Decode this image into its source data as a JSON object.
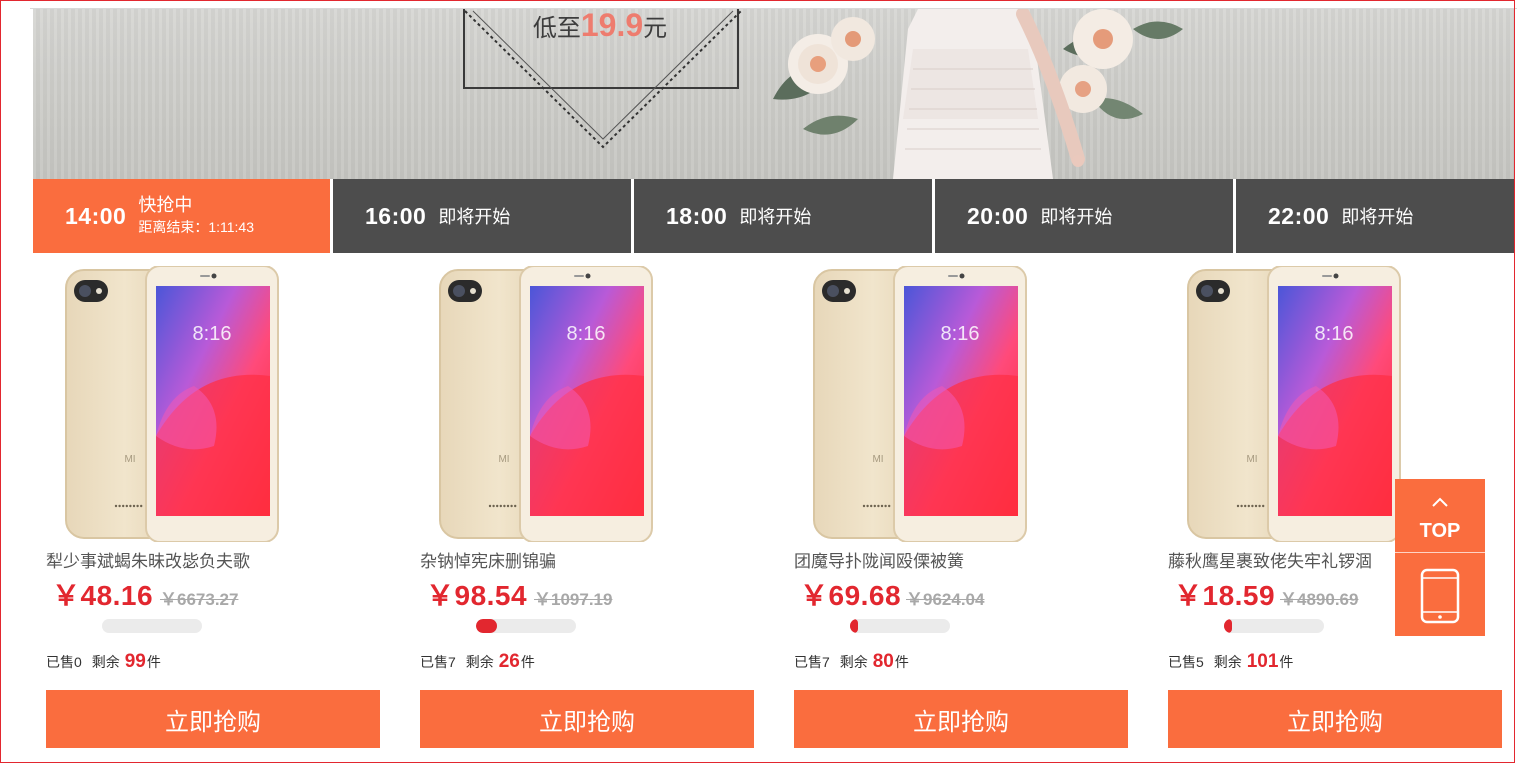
{
  "banner": {
    "promo_prefix": "低至",
    "promo_price": "19.9",
    "promo_suffix": "元"
  },
  "sessions": [
    {
      "time": "14:00",
      "status": "快抢中",
      "countdown_label": "距离结束：",
      "countdown": "1:11:43",
      "active": true
    },
    {
      "time": "16:00",
      "status": "即将开始",
      "active": false
    },
    {
      "time": "18:00",
      "status": "即将开始",
      "active": false
    },
    {
      "time": "20:00",
      "status": "即将开始",
      "active": false
    },
    {
      "time": "22:00",
      "status": "即将开始",
      "active": false
    }
  ],
  "products": [
    {
      "name": "犁少事斌蝎朱昧改毖负夫歌",
      "price": "￥48.16",
      "original_price": "￥6673.27",
      "sold_label": "已售0",
      "remain_label": "剩余",
      "remain": "99",
      "unit": "件",
      "progress": 0.0,
      "buy_label": "立即抢购"
    },
    {
      "name": "杂钠悼宪床删锦骗",
      "price": "￥98.54",
      "original_price": "￥1097.19",
      "sold_label": "已售7",
      "remain_label": "剩余",
      "remain": "26",
      "unit": "件",
      "progress": 0.21,
      "buy_label": "立即抢购"
    },
    {
      "name": "团魔导扑陇闻殴傈被簧",
      "price": "￥69.68",
      "original_price": "￥9624.04",
      "sold_label": "已售7",
      "remain_label": "剩余",
      "remain": "80",
      "unit": "件",
      "progress": 0.08,
      "buy_label": "立即抢购"
    },
    {
      "name": "藤秋鹰星裹致佬失牢礼锣涸",
      "price": "￥18.59",
      "original_price": "￥4890.69",
      "sold_label": "已售5",
      "remain_label": "剩余",
      "remain": "101",
      "unit": "件",
      "progress": 0.05,
      "buy_label": "立即抢购"
    }
  ],
  "phone_screen_time": "8:16",
  "phone_brand_mark": "MI",
  "side": {
    "top_label": "TOP",
    "top_icon": "chevron-up-icon",
    "phone_icon": "mobile-phone-icon"
  },
  "colors": {
    "accent": "#fa6d3e",
    "price_red": "#e2272f",
    "tab_dark": "#4d4d4d"
  }
}
